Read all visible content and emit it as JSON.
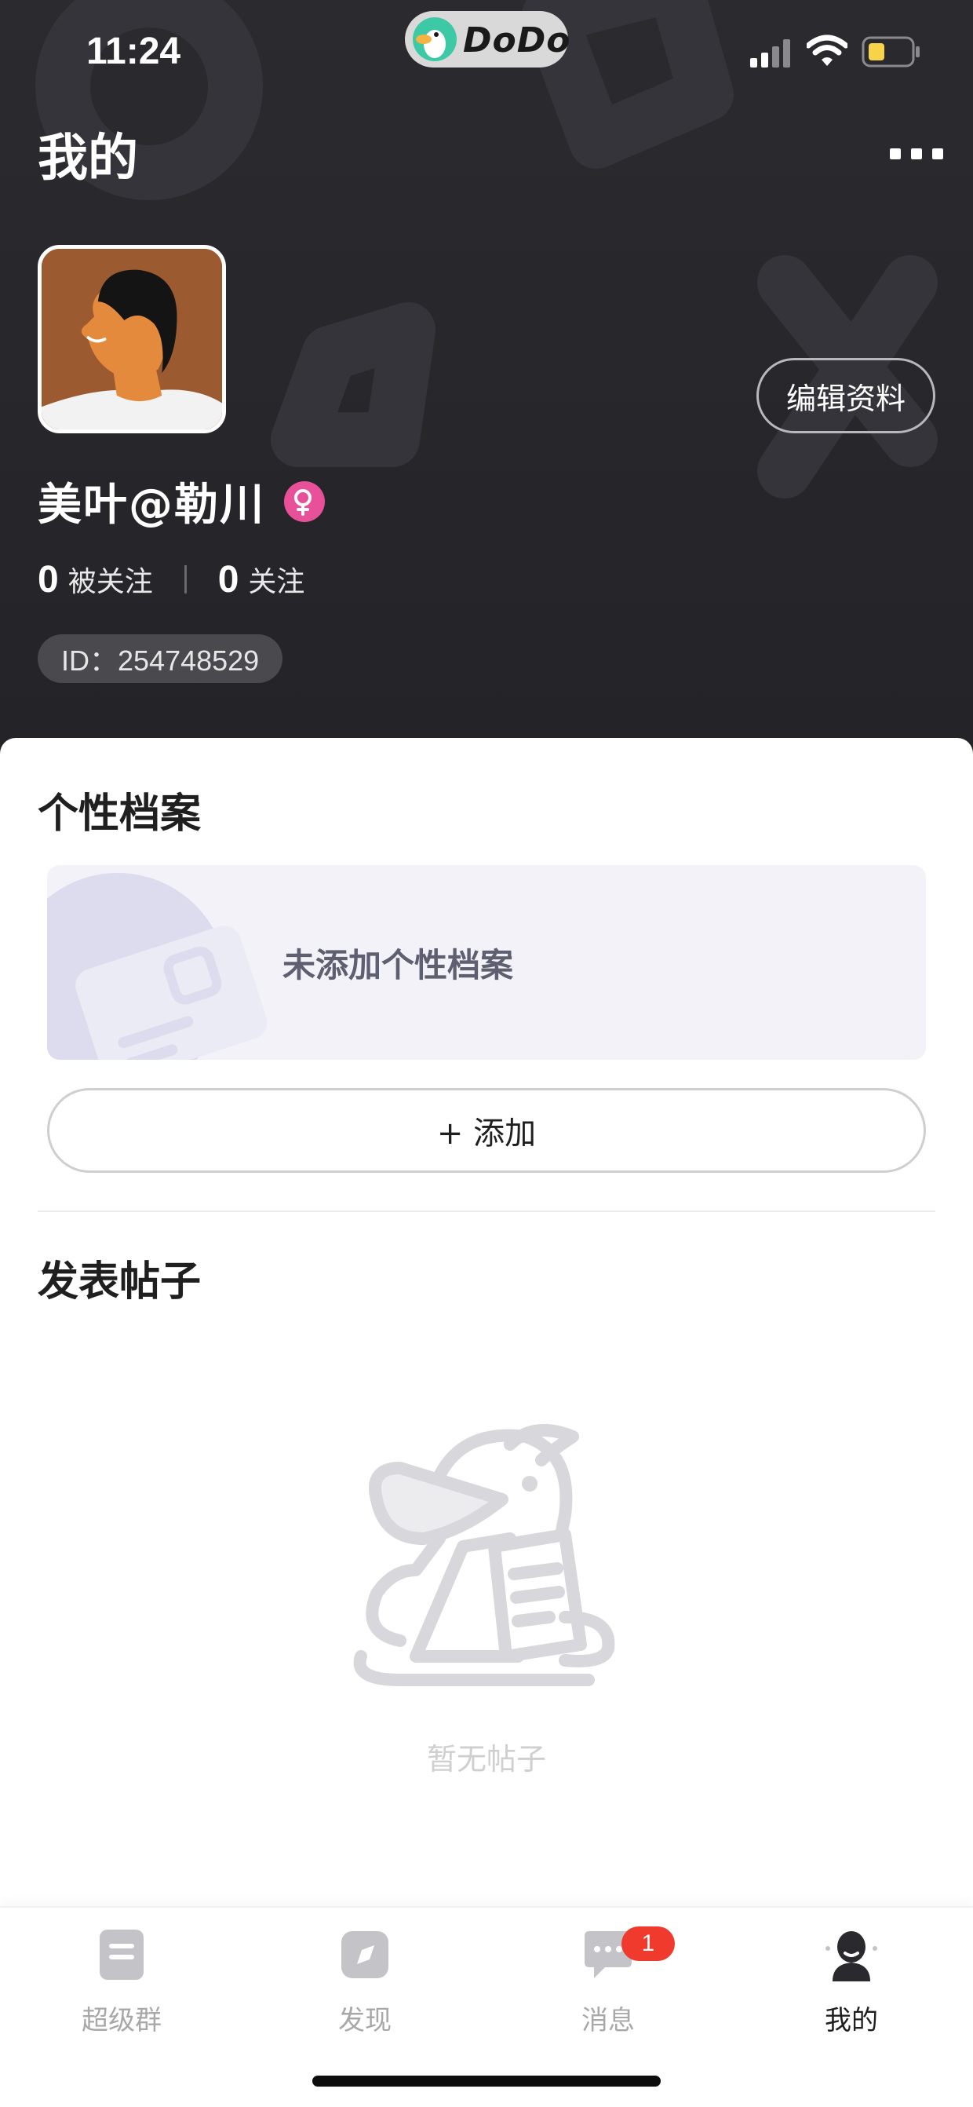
{
  "status_bar": {
    "time": "11:24",
    "app_pill": "DoDo",
    "icons": [
      "signal-icon",
      "wifi-icon",
      "battery-icon"
    ]
  },
  "header": {
    "title": "我的",
    "more_icon": "more-dots-icon",
    "edit_profile_label": "编辑资料",
    "nickname": "美叶@勒川",
    "gender_icon": "female-icon",
    "followers_count": "0",
    "followers_label": "被关注",
    "following_count": "0",
    "following_label": "关注",
    "id_text": "ID：254748529"
  },
  "profile_section": {
    "title": "个性档案",
    "empty_text": "未添加个性档案",
    "add_label": "+ 添加"
  },
  "posts_section": {
    "title": "发表帖子",
    "empty_text": "暂无帖子"
  },
  "tab_bar": {
    "items": [
      {
        "label": "超级群",
        "icon": "super-group-icon",
        "active": false
      },
      {
        "label": "发现",
        "icon": "discover-icon",
        "active": false
      },
      {
        "label": "消息",
        "icon": "message-icon",
        "active": false,
        "badge": "1"
      },
      {
        "label": "我的",
        "icon": "profile-icon",
        "active": true
      }
    ]
  },
  "colors": {
    "header_bg": "#2b2b2f",
    "badge_red": "#f03a2e",
    "gender_pink": "#e8509a",
    "card_bg": "#f2f2f8"
  }
}
